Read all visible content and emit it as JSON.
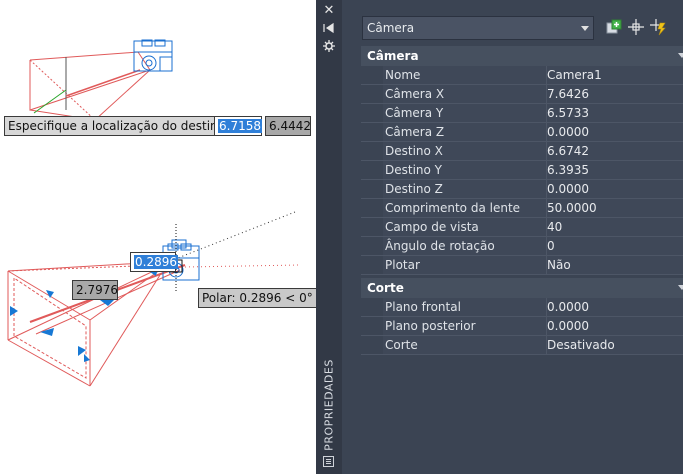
{
  "viewport": {
    "prompt_label": "Especifique a localização do destino:",
    "prompt_x_value": "6.7158",
    "prompt_y_value": "6.4442",
    "dim_value_1": "0.2896",
    "dim_value_2": "2.7976",
    "polar_tooltip": "Polar: 0.2896 < 0°",
    "colors": {
      "frustum": "#e05a5a",
      "camera_blue": "#1a6fd0",
      "grip_blue": "#1778d4",
      "axis_green": "#2aa52a"
    }
  },
  "palette": {
    "strip": {
      "close_icon": "close-icon",
      "pin_icon": "autohide-icon",
      "settings_icon": "settings-icon",
      "title": "PROPRIEDADES"
    },
    "object_selector": "Câmera",
    "sections": [
      {
        "title": "Câmera",
        "rows": [
          {
            "name": "Nome",
            "value": "Camera1"
          },
          {
            "name": "Câmera X",
            "value": "7.6426"
          },
          {
            "name": "Câmera Y",
            "value": "6.5733"
          },
          {
            "name": "Câmera Z",
            "value": "0.0000"
          },
          {
            "name": "Destino X",
            "value": "6.6742"
          },
          {
            "name": "Destino Y",
            "value": "6.3935"
          },
          {
            "name": "Destino Z",
            "value": "0.0000"
          },
          {
            "name": "Comprimento da lente (mm)",
            "value": "50.0000"
          },
          {
            "name": "Campo de vista",
            "value": "40"
          },
          {
            "name": "Ângulo de rotação",
            "value": "0"
          },
          {
            "name": "Plotar",
            "value": "Não"
          }
        ]
      },
      {
        "title": "Corte",
        "rows": [
          {
            "name": "Plano frontal",
            "value": "0.0000"
          },
          {
            "name": "Plano posterior",
            "value": "0.0000"
          },
          {
            "name": "Corte",
            "value": "Desativado"
          }
        ]
      }
    ]
  }
}
